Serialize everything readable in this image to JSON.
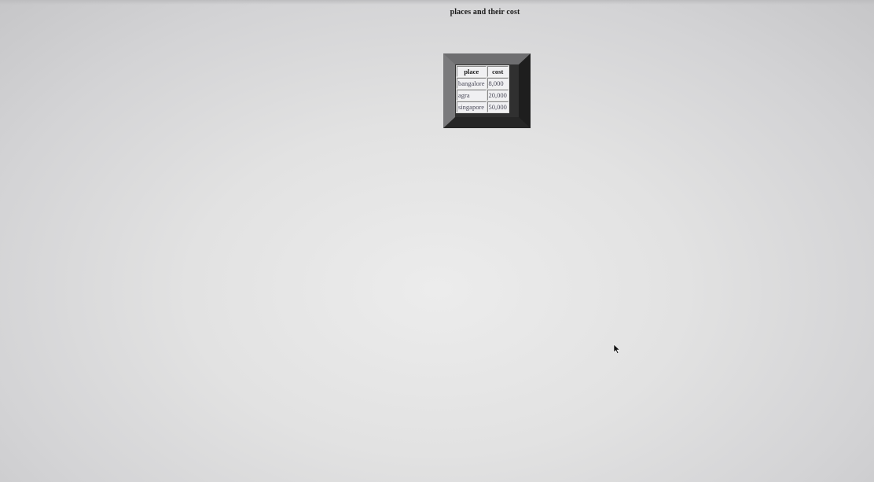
{
  "page": {
    "title": "places and their cost"
  },
  "table": {
    "headers": [
      "place",
      "cost"
    ],
    "rows": [
      [
        "bangalore",
        "8,000"
      ],
      [
        "agra",
        "20,000"
      ],
      [
        "singapore",
        "50,000"
      ]
    ]
  },
  "cursor": {
    "icon": "arrow-cursor-icon"
  }
}
